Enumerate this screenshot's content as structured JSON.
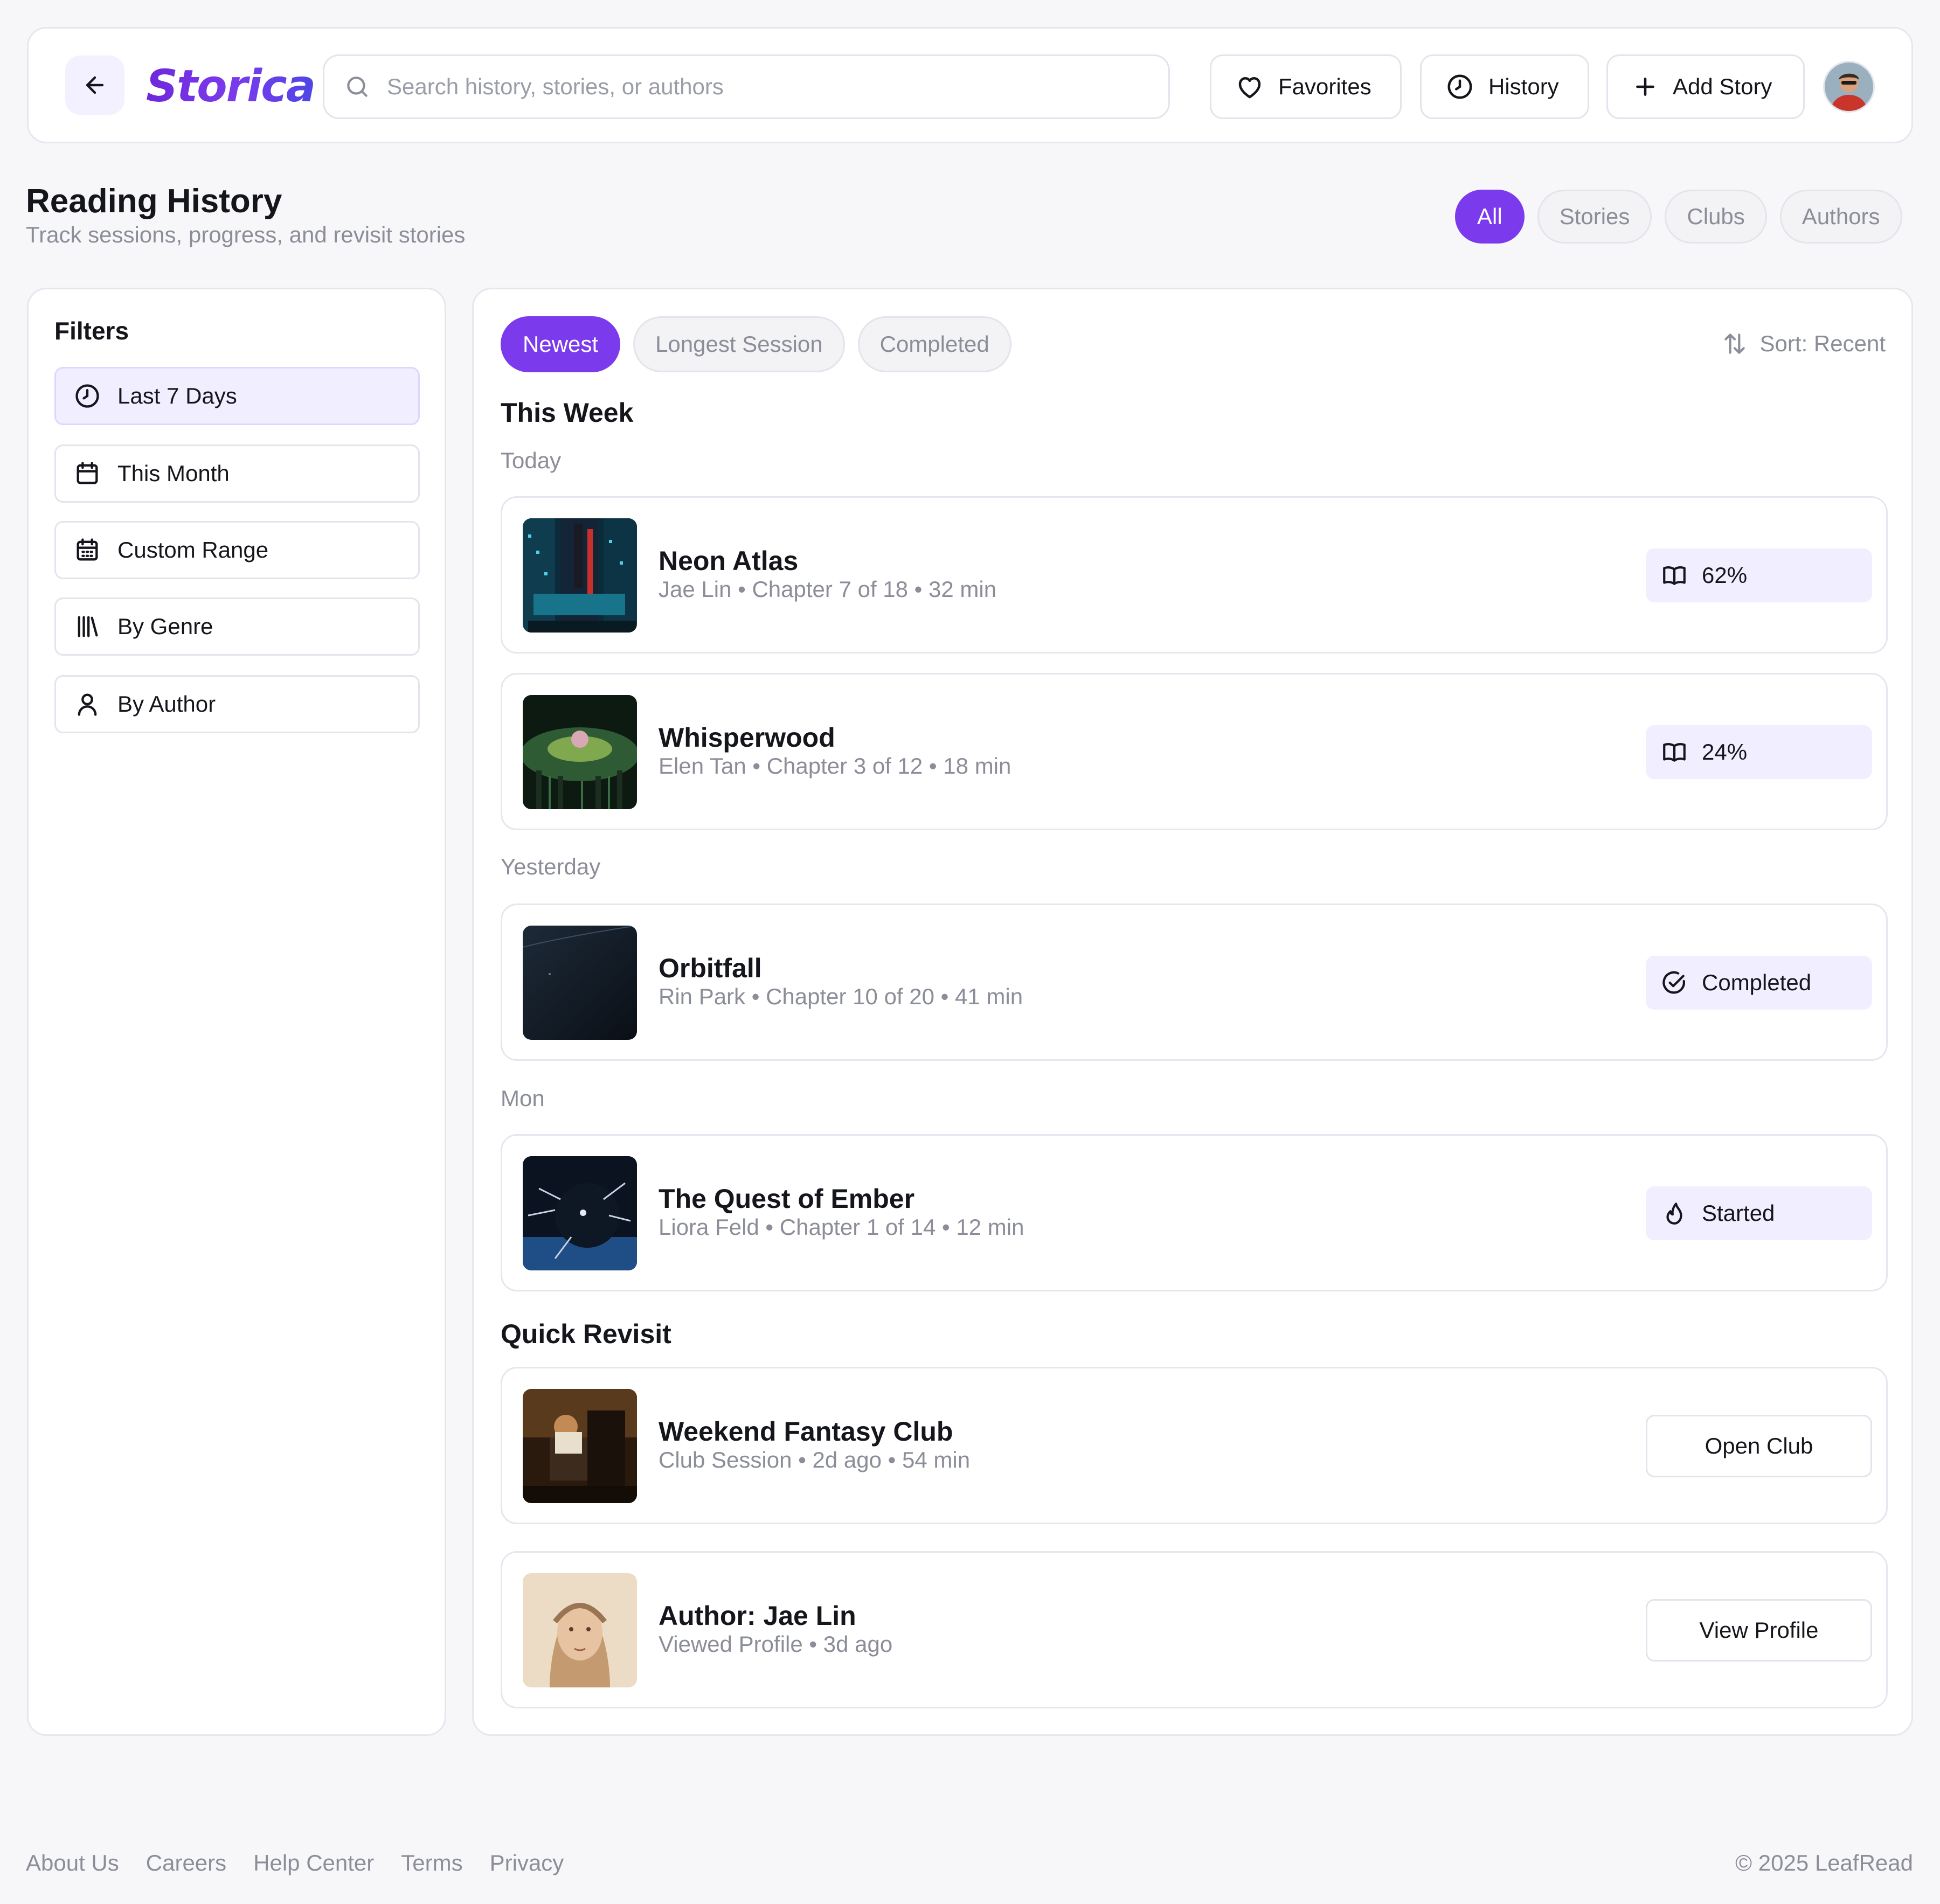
{
  "header": {
    "logo": "Storica",
    "search_placeholder": "Search history, stories, or authors",
    "favorites_label": "Favorites",
    "history_label": "History",
    "add_story_label": "Add Story"
  },
  "page": {
    "title": "Reading History",
    "subtitle": "Track sessions, progress, and revisit stories",
    "tabs": [
      "All",
      "Stories",
      "Clubs",
      "Authors"
    ],
    "active_tab": "All"
  },
  "sidebar": {
    "title": "Filters",
    "items": [
      {
        "label": "Last 7 Days",
        "icon": "clock-icon",
        "active": true
      },
      {
        "label": "This Month",
        "icon": "calendar-icon",
        "active": false
      },
      {
        "label": "Custom Range",
        "icon": "calendar-grid-icon",
        "active": false
      },
      {
        "label": "By Genre",
        "icon": "library-icon",
        "active": false
      },
      {
        "label": "By Author",
        "icon": "user-icon",
        "active": false
      }
    ]
  },
  "main": {
    "chips": [
      "Newest",
      "Longest Session",
      "Completed"
    ],
    "active_chip": "Newest",
    "sort_label": "Sort: Recent",
    "this_week_title": "This Week",
    "day_today": "Today",
    "day_yesterday": "Yesterday",
    "day_mon": "Mon",
    "quick_revisit_title": "Quick Revisit",
    "entries": [
      {
        "title": "Neon Atlas",
        "meta": "Jae Lin • Chapter 7 of 18 • 32 min",
        "status": "62%",
        "status_icon": "book-open-icon"
      },
      {
        "title": "Whisperwood",
        "meta": "Elen Tan • Chapter 3 of 12 • 18 min",
        "status": "24%",
        "status_icon": "book-open-icon"
      },
      {
        "title": "Orbitfall",
        "meta": "Rin Park • Chapter 10 of 20 • 41 min",
        "status": "Completed",
        "status_icon": "check-circle-icon"
      },
      {
        "title": "The Quest of Ember",
        "meta": "Liora Feld • Chapter 1 of 14 • 12 min",
        "status": "Started",
        "status_icon": "flame-icon"
      }
    ],
    "revisit": [
      {
        "title": "Weekend Fantasy Club",
        "meta": "Club Session • 2d ago • 54 min",
        "action": "Open Club"
      },
      {
        "title": "Author: Jae Lin",
        "meta": "Viewed Profile • 3d ago",
        "action": "View Profile"
      }
    ]
  },
  "footer": {
    "links": [
      "About Us",
      "Careers",
      "Help Center",
      "Terms",
      "Privacy"
    ],
    "copyright": "© 2025 LeafRead"
  },
  "colors": {
    "accent": "#7c3aed",
    "accent_soft": "#f1eeff",
    "muted_text": "#8b8d98",
    "border": "#e3e4ec"
  }
}
